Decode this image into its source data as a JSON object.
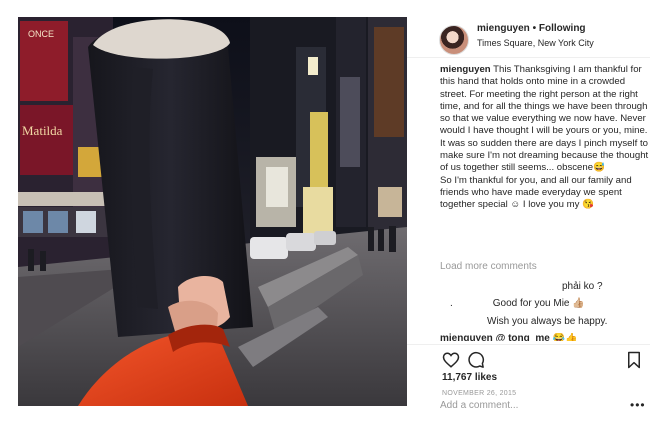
{
  "post": {
    "username": "mienguyen",
    "separator": "•",
    "follow_status": "Following",
    "location": "Times Square, New York City",
    "caption_paragraphs": [
      "This Thanksgiving I am thankful for this hand that holds onto mine in a crowded street. For meeting the right person at the right time, and for all the things we have been through so that we value everything we now have. Never would I have thought I will be yours or you, mine. It was so sudden there are days I pinch myself to make sure I'm not dreaming because the thought of us together still seems... obscene😅",
      "So I'm thankful for you, and all our family and friends who have made everyday we spent together special ☺ I love you my 😘"
    ],
    "load_more": "Load more comments",
    "comments": [
      "phải ko ?",
      "Good for you Mie 👍🏼",
      "Wish you always be happy.",
      "mienguyen @ tong_me 😂👍"
    ],
    "comment_dot": ".",
    "likes": "11,767 likes",
    "date": "NOVEMBER 26, 2015",
    "add_comment_placeholder": "Add a comment...",
    "more_label": "•••"
  },
  "photo_signs": {
    "matilda": "Matilda",
    "once": "ONCE"
  },
  "icons": [
    "heart-icon",
    "comment-icon",
    "share-icon",
    "bookmark-icon",
    "more-options-icon"
  ],
  "colors": {
    "muted": "#999999",
    "text": "#262626",
    "border": "#efefef",
    "sleeve": "#e2431c"
  }
}
